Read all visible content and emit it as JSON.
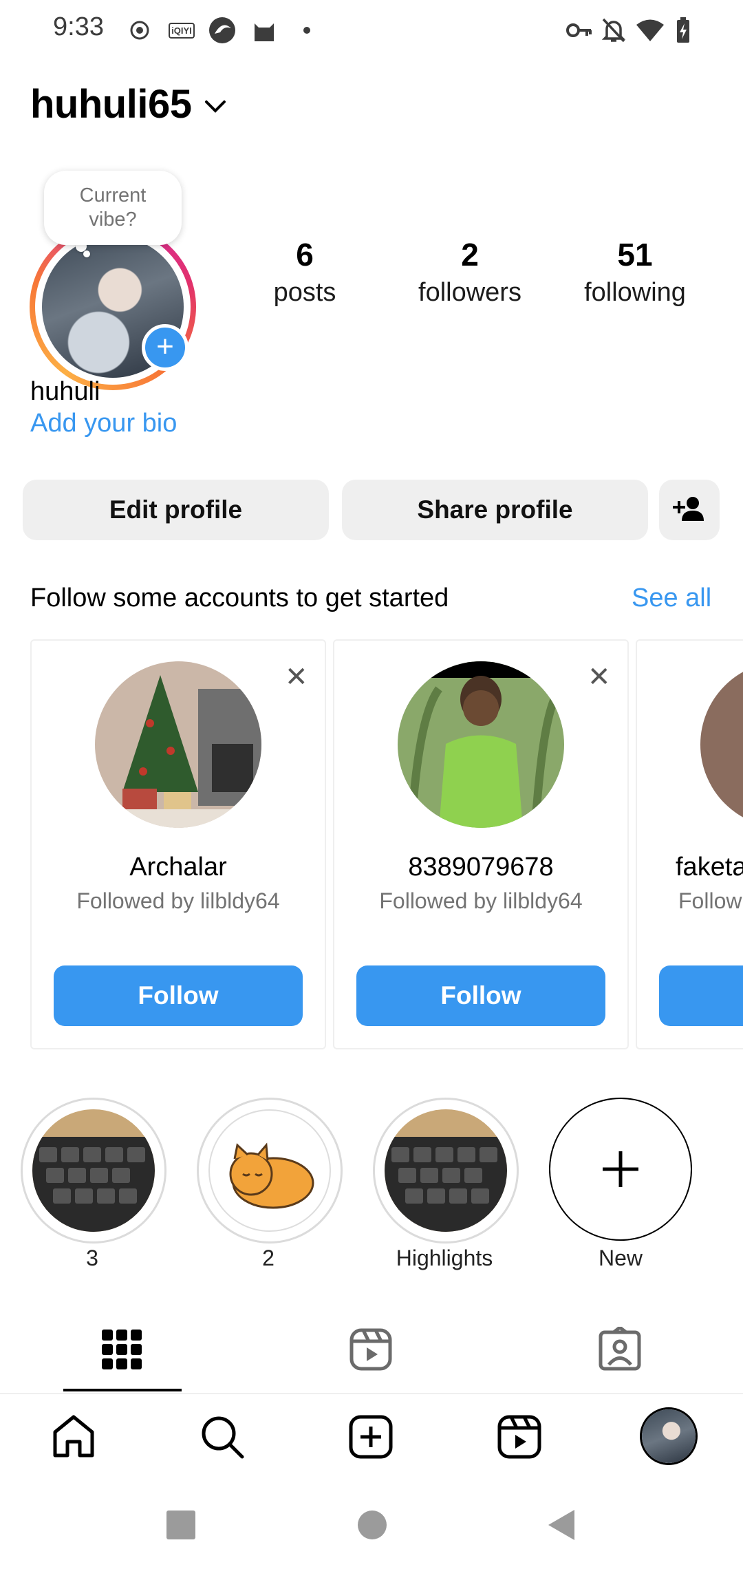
{
  "status_bar": {
    "time": "9:33",
    "left_icons": [
      "record-icon",
      "iqiyi-icon",
      "browser-icon",
      "cat-icon",
      "dot-icon"
    ],
    "iqiyi_text": "iQIYI",
    "right_icons": [
      "key-icon",
      "bell-off-icon",
      "wifi-icon",
      "battery-charging-icon"
    ]
  },
  "header": {
    "username": "huhuli65",
    "dropdown_icon": "chevron-down-icon"
  },
  "profile": {
    "vibe_prompt": "Current vibe?",
    "stats": [
      {
        "value": "6",
        "label": "posts"
      },
      {
        "value": "2",
        "label": "followers"
      },
      {
        "value": "51",
        "label": "following"
      }
    ],
    "display_name": "huhuli",
    "bio_link": "Add your bio"
  },
  "actions": {
    "edit_profile": "Edit profile",
    "share_profile": "Share profile",
    "discover_icon": "add-person-icon"
  },
  "suggestions": {
    "title": "Follow some accounts to get started",
    "see_all": "See all",
    "cards": [
      {
        "name": "Archalar",
        "subtitle": "Followed by lilbldy64",
        "button": "Follow"
      },
      {
        "name": "8389079678",
        "subtitle": "Followed by lilbldy64",
        "button": "Follow"
      },
      {
        "name": "faketa",
        "subtitle": "Follow",
        "button": ""
      }
    ]
  },
  "highlights": [
    {
      "label": "3"
    },
    {
      "label": "2"
    },
    {
      "label": "Highlights"
    },
    {
      "label": "New"
    }
  ],
  "profile_tabs": [
    "grid-icon",
    "reels-icon",
    "tagged-icon"
  ],
  "bottom_nav": [
    "home-icon",
    "search-icon",
    "create-icon",
    "reels-icon",
    "profile-avatar"
  ],
  "system_nav": [
    "recents-square",
    "home-circle",
    "back-triangle"
  ],
  "colors": {
    "accent": "#3897f0",
    "button_grey": "#efefef"
  }
}
